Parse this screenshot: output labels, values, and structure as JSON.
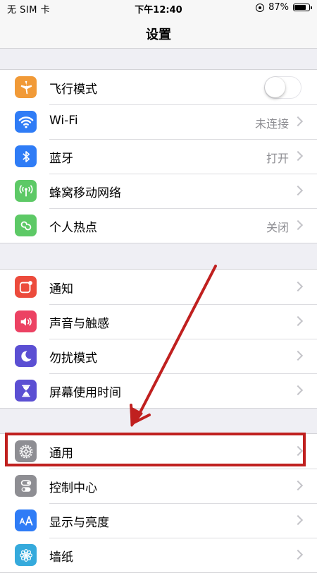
{
  "status_bar": {
    "carrier": "无 SIM 卡",
    "time": "下午12:40",
    "battery_text": "87%",
    "battery_level": 0.87
  },
  "nav": {
    "title": "设置"
  },
  "groups": [
    {
      "items": [
        {
          "label": "飞行模式",
          "icon": "airplane-icon",
          "icon_color": "#f19a37",
          "control": "toggle",
          "toggle_on": false
        },
        {
          "label": "Wi-Fi",
          "icon": "wifi-icon",
          "icon_color": "#2f7cf6",
          "value": "未连接"
        },
        {
          "label": "蓝牙",
          "icon": "bluetooth-icon",
          "icon_color": "#2f7cf6",
          "value": "打开"
        },
        {
          "label": "蜂窝移动网络",
          "icon": "cellular-icon",
          "icon_color": "#5dc966"
        },
        {
          "label": "个人热点",
          "icon": "hotspot-icon",
          "icon_color": "#5dc966",
          "value": "关闭"
        }
      ]
    },
    {
      "items": [
        {
          "label": "通知",
          "icon": "notifications-icon",
          "icon_color": "#ec4b3c"
        },
        {
          "label": "声音与触感",
          "icon": "sound-icon",
          "icon_color": "#ec4263"
        },
        {
          "label": "勿扰模式",
          "icon": "moon-icon",
          "icon_color": "#5b4fd3"
        },
        {
          "label": "屏幕使用时间",
          "icon": "hourglass-icon",
          "icon_color": "#5b4fd3"
        }
      ]
    },
    {
      "items": [
        {
          "label": "通用",
          "icon": "gear-icon",
          "icon_color": "#8e8e93"
        },
        {
          "label": "控制中心",
          "icon": "control-center-icon",
          "icon_color": "#8e8e93"
        },
        {
          "label": "显示与亮度",
          "icon": "display-icon",
          "icon_color": "#2f7cf6"
        },
        {
          "label": "墙纸",
          "icon": "wallpaper-icon",
          "icon_color": "#35aadc"
        }
      ]
    }
  ],
  "annotation": {
    "color": "#c0201f"
  }
}
